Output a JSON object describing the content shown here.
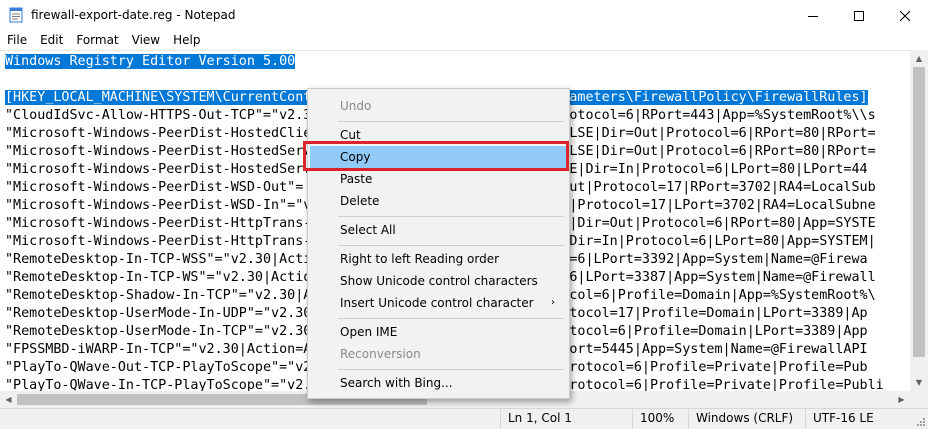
{
  "window": {
    "title": "firewall-export-date.reg - Notepad"
  },
  "menubar": {
    "items": [
      "File",
      "Edit",
      "Format",
      "View",
      "Help"
    ]
  },
  "editor": {
    "lines": [
      "Windows Registry Editor Version 5.00",
      "",
      "[HKEY_LOCAL_MACHINE\\SYSTEM\\CurrentControlSet\\Services\\SharedAccess\\Parameters\\FirewallPolicy\\FirewallRules]",
      "\"CloudIdSvc-Allow-HTTPS-Out-TCP\"=\"v2.3                           ut|Protocol=6|RPort=443|App=%SystemRoot%\\\\s",
      "\"Microsoft-Windows-PeerDist-HostedClie                           ve=FALSE|Dir=Out|Protocol=6|RPort=80|RPort=",
      "\"Microsoft-Windows-PeerDist-HostedServ                           ve=FALSE|Dir=Out|Protocol=6|RPort=80|RPort=",
      "\"Microsoft-Windows-PeerDist-HostedServ                           =FALSE|Dir=In|Protocol=6|LPort=80|LPort=44",
      "\"Microsoft-Windows-PeerDist-WSD-Out\"=                            Dir=Out|Protocol=17|RPort=3702|RA4=LocalSub",
      "\"Microsoft-Windows-PeerDist-WSD-In\"=\"v                           ir=In|Protocol=17|LPort=3702|RA4=LocalSubne",
      "\"Microsoft-Windows-PeerDist-HttpTrans-                           FALSE|Dir=Out|Protocol=6|RPort=80|App=SYSTE",
      "\"Microsoft-Windows-PeerDist-HttpTrans-                           ALSE|Dir=In|Protocol=6|LPort=80|App=SYSTEM|",
      "\"RemoteDesktop-In-TCP-WSS\"=\"v2.30|Acti                           tocol=6|LPort=3392|App=System|Name=@Firewa",
      "\"RemoteDesktop-In-TCP-WS\"=\"v2.30|Actio                           ocol=6|LPort=3387|App=System|Name=@Firewall",
      "\"RemoteDesktop-Shadow-In-TCP\"=\"v2.30|A                           Protocol=6|Profile=Domain|App=%SystemRoot%\\",
      "\"RemoteDesktop-UserMode-In-UDP\"=\"v2.30                           n|Protocol=17|Profile=Domain|LPort=3389|Ap",
      "\"RemoteDesktop-UserMode-In-TCP\"=\"v2.30                           n|Protocol=6|Profile=Domain|LPort=3389|App",
      "\"FPSSMBD-iWARP-In-TCP\"=\"v2.30|Action=A                           =6|LPort=5445|App=System|Name=@FirewallAPI",
      "\"PlayTo-QWave-Out-TCP-PlayToScope\"=\"v2                           Out|Protocol=6|Profile=Private|Profile=Pub",
      "\"PlayTo-QWave-In-TCP-PlayToScope\"=\"v2.                           =In|Protocol=6|Profile=Private|Profile=Publi"
    ]
  },
  "context_menu": {
    "items": [
      {
        "label": "Undo",
        "disabled": true
      },
      {
        "label": "Cut",
        "disabled": false
      },
      {
        "label": "Copy",
        "disabled": false,
        "highlighted": true
      },
      {
        "label": "Paste",
        "disabled": false
      },
      {
        "label": "Delete",
        "disabled": false
      },
      {
        "label": "Select All",
        "disabled": false
      },
      {
        "label": "Right to left Reading order",
        "disabled": false
      },
      {
        "label": "Show Unicode control characters",
        "disabled": false
      },
      {
        "label": "Insert Unicode control character",
        "disabled": false,
        "submenu": true
      },
      {
        "label": "Open IME",
        "disabled": false
      },
      {
        "label": "Reconversion",
        "disabled": true
      },
      {
        "label": "Search with Bing...",
        "disabled": false
      }
    ]
  },
  "statusbar": {
    "position": "Ln 1, Col 1",
    "zoom": "100%",
    "line_ending": "Windows (CRLF)",
    "encoding": "UTF-16 LE"
  },
  "colors": {
    "selection": "#0078d7",
    "menu_highlight": "#91c9f7",
    "callout_border": "#d9242c"
  },
  "icons": {
    "app": "notepad-icon",
    "minimize": "minimize-icon",
    "maximize": "maximize-icon",
    "close": "close-icon",
    "submenu": "chevron-right-icon"
  }
}
